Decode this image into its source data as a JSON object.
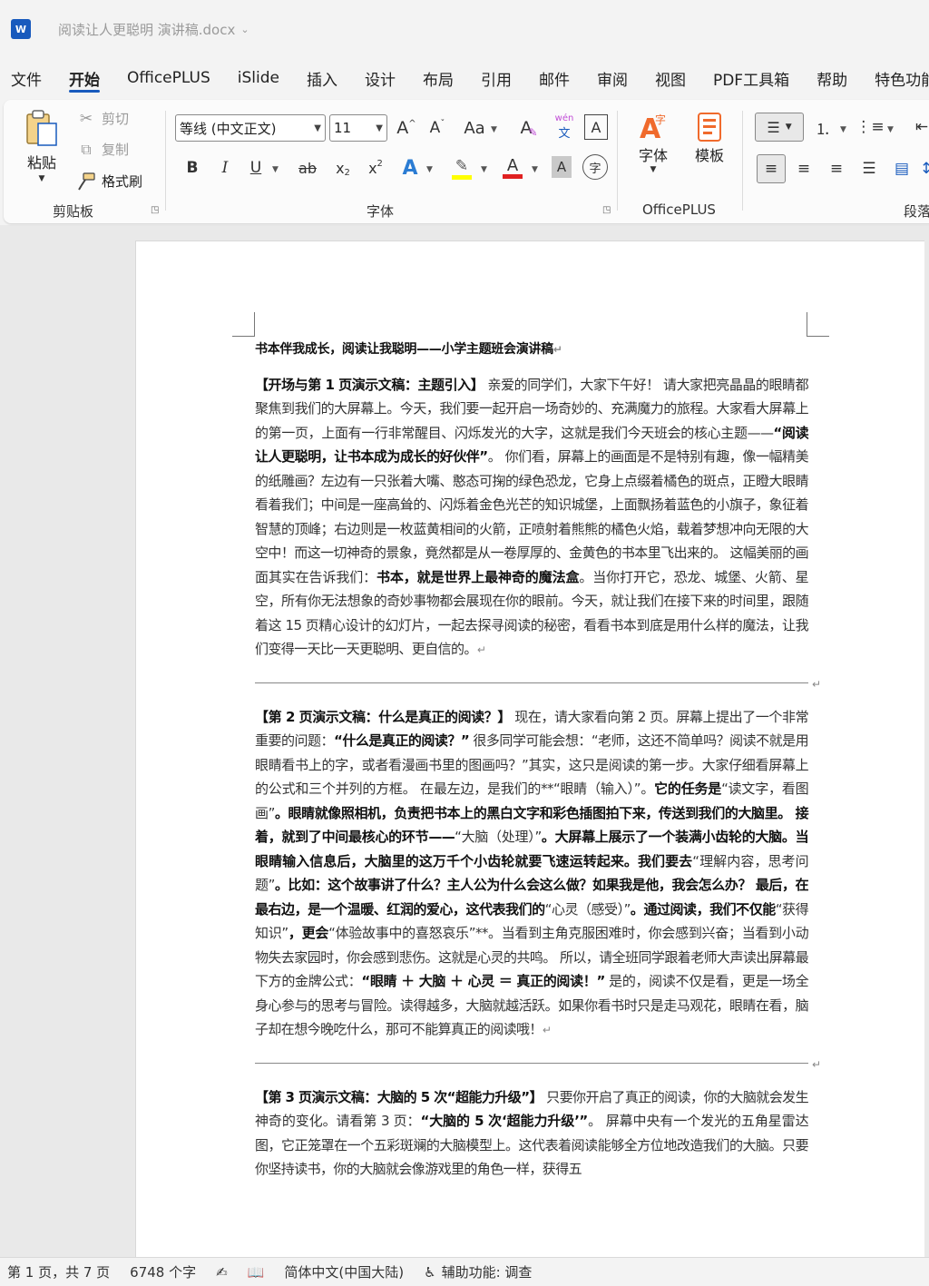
{
  "window": {
    "app_icon_letter": "W",
    "doc_title": "阅读让人更聪明 演讲稿.docx"
  },
  "menu": {
    "tabs": [
      "文件",
      "开始",
      "OfficePLUS",
      "iSlide",
      "插入",
      "设计",
      "布局",
      "引用",
      "邮件",
      "审阅",
      "视图",
      "PDF工具箱",
      "帮助",
      "特色功能"
    ],
    "active": "开始"
  },
  "ribbon": {
    "clipboard": {
      "paste": "粘贴",
      "cut": "剪切",
      "copy": "复制",
      "format_painter": "格式刷",
      "label": "剪贴板"
    },
    "font": {
      "font_name": "等线 (中文正文)",
      "font_size": "11",
      "label": "字体",
      "aa_label": "Aa",
      "pinyin_label": "wén"
    },
    "officeplus": {
      "font_btn": "字体",
      "template_btn": "模板",
      "label": "OfficePLUS"
    },
    "paragraph": {
      "label": "段落"
    },
    "colors": {
      "accent": "#185abd",
      "highlight": "#ffff00",
      "font_color": "#e02020"
    }
  },
  "document": {
    "title": "书本伴我成长，阅读让我聪明——小学主题班会演讲稿",
    "p1": {
      "s1": "【开场与第 1 页演示文稿：主题引入】",
      "s2": " 亲爱的同学们，大家下午好！ 请大家把亮晶晶的眼睛都聚焦到我们的大屏幕上。今天，我们要一起开启一场奇妙的、充满魔力的旅程。大家看大屏幕上的第一页，上面有一行非常醒目、闪烁发光的大字，这就是我们今天班会的核心主题——",
      "s3": "“阅读让人更聪明，让书本成为成长的好伙伴”",
      "s4": "。 你们看，屏幕上的画面是不是特别有趣，像一幅精美的纸雕画？左边有一只张着大嘴、憨态可掬的绿色恐龙，它身上点缀着橘色的斑点，正瞪大眼睛看着我们；中间是一座高耸的、闪烁着金色光芒的知识城堡，上面飘扬着蓝色的小旗子，象征着智慧的顶峰；右边则是一枚蓝黄相间的火箭，正喷射着熊熊的橘色火焰，载着梦想冲向无限的大空中！而这一切神奇的景象，竟然都是从一卷厚厚的、金黄色的书本里飞出来的。 这幅美丽的画面其实在告诉我们：",
      "s5": "书本，就是世界上最神奇的魔法盒",
      "s6": "。当你打开它，恐龙、城堡、火箭、星空，所有你无法想象的奇妙事物都会展现在你的眼前。今天，就让我们在接下来的时间里，跟随着这 15 页精心设计的幻灯片，一起去探寻阅读的秘密，看看书本到底是用什么样的魔法，让我们变得一天比一天更聪明、更自信的。"
    },
    "p2": {
      "s1": "【第 2 页演示文稿：什么是真正的阅读？】",
      "s2": " 现在，请大家看向第 2 页。屏幕上提出了一个非常重要的问题：",
      "s3": "“什么是真正的阅读？”",
      "s4": " 很多同学可能会想：“老师，这还不简单吗？阅读不就是用眼睛看书上的字，或者看漫画书里的图画吗？”其实，这只是阅读的第一步。大家仔细看屏幕上的公式和三个并列的方框。 在最左边，是我们的**“眼睛（输入）”。",
      "s5": "它的任务是",
      "s6": "“读文字，看图画”",
      "s7": "。眼睛就像照相机，负责把书本上的黑白文字和彩色插图拍下来，传送到我们的大脑里。 接着，就到了中间最核心的环节——",
      "s8": "“大脑（处理）”",
      "s9": "。大屏幕上展示了一个装满小齿轮的大脑。当眼睛输入信息后，大脑里的这万千个小齿轮就要飞速运转起来。我们要去",
      "s10": "“理解内容，思考问题”",
      "s11": "。比如：这个故事讲了什么？主人公为什么会这么做？如果我是他，我会怎么办？ 最后，在最右边，是一个温暖、红润的爱心，这代表我们的",
      "s12": "“心灵（感受）”",
      "s13": "。通过阅读，我们不仅能",
      "s14": "“获得知识”",
      "s15": "，更会",
      "s16": "“体验故事中的喜怒哀乐”**。当看到主角克服困难时，你会感到兴奋；当看到小动物失去家园时，你会感到悲伤。这就是心灵的共鸣。 所以，请全班同学跟着老师大声读出屏幕最下方的金牌公式：",
      "s17": "“眼睛 ＋ 大脑 ＋ 心灵 ＝ 真正的阅读！”",
      "s18": " 是的，阅读不仅是看，更是一场全身心参与的思考与冒险。读得越多，大脑就越活跃。如果你看书时只是走马观花，眼睛在看，脑子却在想今晚吃什么，那可不能算真正的阅读哦！"
    },
    "p3": {
      "s1": "【第 3 页演示文稿：大脑的 5 次“超能力升级”】",
      "s2": " 只要你开启了真正的阅读，你的大脑就会发生神奇的变化。请看第 3 页：",
      "s3": "“大脑的 5 次‘超能力升级’”",
      "s4": "。 屏幕中央有一个发光的五角星雷达图，它正笼罩在一个五彩斑斓的大脑模型上。这代表着阅读能够全方位地改造我们的大脑。只要你坚持读书，你的大脑就会像游戏里的角色一样，获得五"
    },
    "para_mark": "↵"
  },
  "status": {
    "page": "第 1 页，共 7 页",
    "words": "6748 个字",
    "language": "简体中文(中国大陆)",
    "accessibility": "辅助功能: 调查"
  }
}
